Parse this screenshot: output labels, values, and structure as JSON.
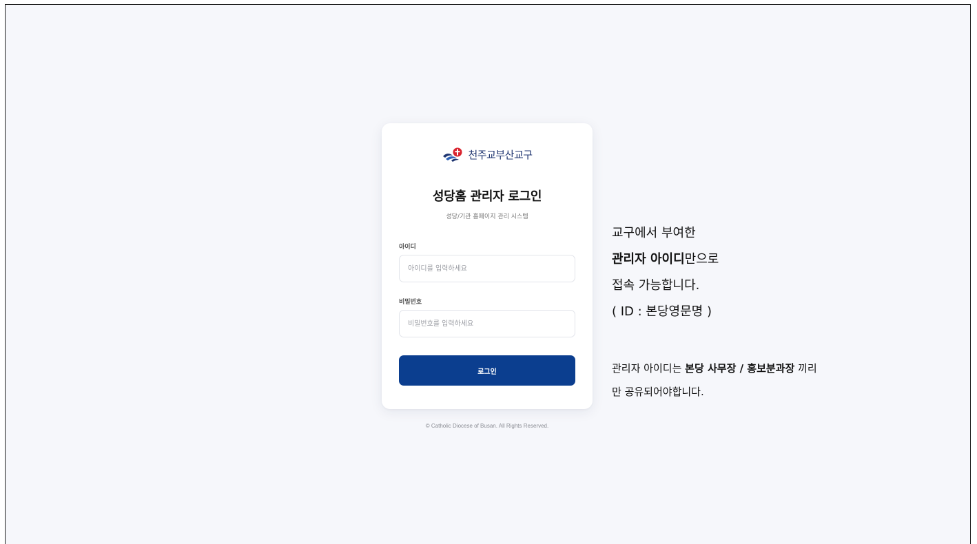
{
  "brand": {
    "name": "천주교부산교구",
    "colors": {
      "navy": "#1f3570",
      "red": "#d9232e",
      "button": "#0b3e8f"
    }
  },
  "login": {
    "title": "성당홈 관리자 로그인",
    "subtitle": "성당/기관 홈페이지 관리 시스템",
    "id_label": "아이디",
    "id_placeholder": "아이디를 입력하세요",
    "id_value": "",
    "password_label": "비밀번호",
    "password_placeholder": "비밀번호를 입력하세요",
    "password_value": "",
    "submit_label": "로그인"
  },
  "footer": {
    "copyright": "© Catholic Diocese of Busan. All Rights Reserved."
  },
  "info": {
    "line1": "교구에서 부여한",
    "line2_bold": "관리자 아이디",
    "line2_rest": "만으로",
    "line3": "접속 가능합니다.",
    "line4": "( ID : 본당영문명 )"
  },
  "note": {
    "part1": "관리자 아이디는 ",
    "part2_bold": "본당 사무장 / 홍보분과장",
    "part3": " 끼리",
    "line2": "만 공유되어야합니다."
  }
}
